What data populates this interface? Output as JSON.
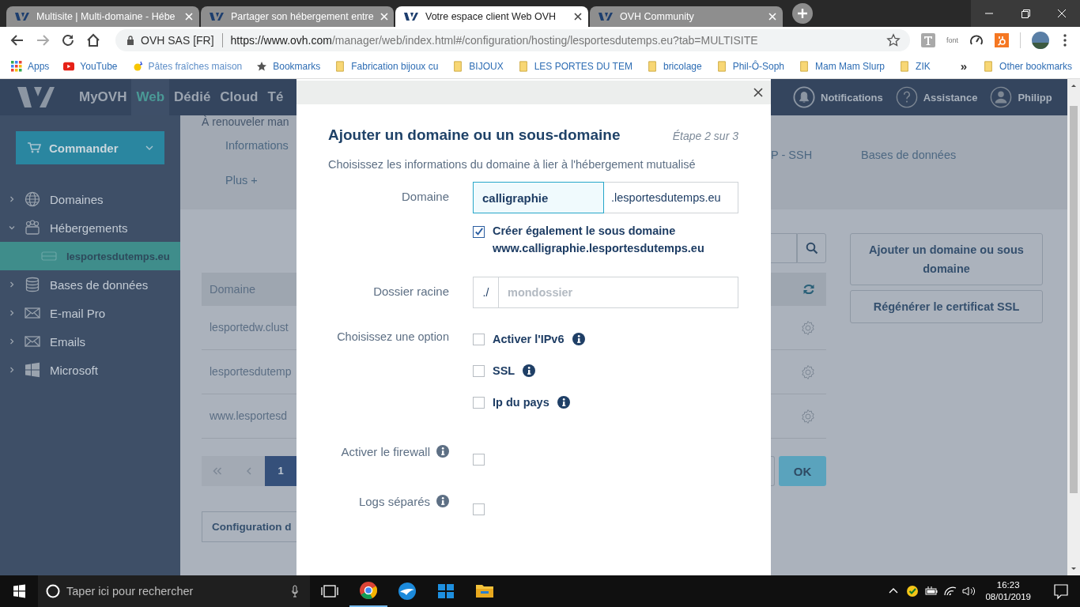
{
  "browser": {
    "tabs": [
      {
        "title": "Multisite | Multi-domaine - Hébe",
        "selected": false
      },
      {
        "title": "Partager son hébergement entre",
        "selected": false
      },
      {
        "title": "Votre espace client Web OVH",
        "selected": true
      },
      {
        "title": "OVH Community",
        "selected": false
      }
    ],
    "address": {
      "site_identity": "OVH SAS [FR]",
      "url_origin": "https://www.ovh.com",
      "url_path": "/manager/web/index.html#/configuration/hosting/lesportesdutemps.eu?tab=MULTISITE"
    },
    "extension_label": "font",
    "bookmarks": [
      {
        "label": "Apps",
        "kind": "apps"
      },
      {
        "label": "YouTube",
        "kind": "video"
      },
      {
        "label": "Pâtes fraîches maison",
        "kind": "site"
      },
      {
        "label": "Bookmarks",
        "kind": "star"
      },
      {
        "label": "Fabrication bijoux cu",
        "kind": "folder"
      },
      {
        "label": "BIJOUX",
        "kind": "folder"
      },
      {
        "label": "LES PORTES DU TEM",
        "kind": "folder"
      },
      {
        "label": "bricolage",
        "kind": "folder"
      },
      {
        "label": "Phil-Ô-Soph",
        "kind": "folder"
      },
      {
        "label": "Mam Mam Slurp",
        "kind": "folder"
      },
      {
        "label": "ZIK",
        "kind": "folder"
      }
    ],
    "more_bookmarks": "»",
    "other_bookmarks": "Other bookmarks"
  },
  "app": {
    "nav": [
      {
        "label": "MyOVH",
        "selected": false
      },
      {
        "label": "Web",
        "selected": true
      },
      {
        "label": "Dédié",
        "selected": false
      },
      {
        "label": "Cloud",
        "selected": false
      },
      {
        "label": "Té",
        "selected": false
      }
    ],
    "nav_right": [
      {
        "label": "Notifications",
        "kind": "bell"
      },
      {
        "label": "Assistance",
        "kind": "help"
      },
      {
        "label": "Philipp",
        "kind": "user"
      }
    ],
    "order_button": "Commander",
    "sidebar": [
      {
        "label": "Domaines",
        "kind": "globe",
        "expanded": false,
        "selected": false
      },
      {
        "label": "Hébergements",
        "kind": "hosting",
        "expanded": true,
        "selected": false,
        "children": [
          {
            "label": "lesportesdutemps.eu",
            "selected": true
          }
        ]
      },
      {
        "label": "Bases de données",
        "kind": "database",
        "expanded": false,
        "selected": false
      },
      {
        "label": "E-mail Pro",
        "kind": "mail",
        "expanded": false,
        "selected": false
      },
      {
        "label": "Emails",
        "kind": "mail",
        "expanded": false,
        "selected": false
      },
      {
        "label": "Microsoft",
        "kind": "windows",
        "expanded": false,
        "selected": false
      }
    ],
    "renewal_note": "À renouveler man",
    "tabs": [
      {
        "label": "Informations"
      },
      {
        "label": "P - SSH"
      },
      {
        "label": "Bases de données"
      },
      {
        "label": "Plus +"
      }
    ],
    "table": {
      "columns": [
        "Domaine"
      ],
      "rows": [
        "lesportedw.clust",
        "lesportesdutemp",
        "www.lesportesd"
      ]
    },
    "pages": [
      {
        "label": "1",
        "selected": true
      }
    ],
    "go_button": "OK",
    "config_button": "Configuration d",
    "actions": [
      "Ajouter un domaine ou sous domaine",
      "Régénérer le certificat SSL"
    ]
  },
  "dialog": {
    "title": "Ajouter un domaine ou un sous-domaine",
    "step": "Étape 2 sur 3",
    "subtitle": "Choisissez les informations du domaine à lier à l'hébergement mutualisé",
    "domain": {
      "label": "Domaine",
      "value": "calligraphie",
      "suffix": ".lesportesdutemps.eu"
    },
    "www_option": {
      "label": "Créer également le sous domaine",
      "detail": "www.calligraphie.lesportesdutemps.eu",
      "checked": true
    },
    "root_folder": {
      "label": "Dossier racine",
      "prefix": "./",
      "placeholder": "mondossier"
    },
    "options_label": "Choisissez une option",
    "options": [
      {
        "label": "Activer l'IPv6",
        "checked": false
      },
      {
        "label": "SSL",
        "checked": false
      },
      {
        "label": "Ip du pays",
        "checked": false
      }
    ],
    "firewall": {
      "label": "Activer le firewall",
      "checked": false
    },
    "separate_logs": {
      "label": "Logs séparés",
      "checked": false
    }
  },
  "taskbar": {
    "search_placeholder": "Taper ici pour rechercher",
    "time": "16:23",
    "date": "08/01/2019"
  }
}
